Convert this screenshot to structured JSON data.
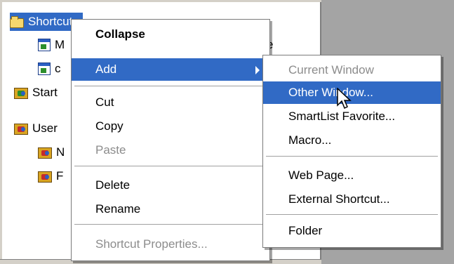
{
  "tree": {
    "items": [
      {
        "label": "Shortcuts",
        "icon": "folder-icon"
      },
      {
        "label": "M",
        "icon": "window-icon"
      },
      {
        "label": "c",
        "icon": "window-icon"
      },
      {
        "label": "Start",
        "icon": "group-icon-green"
      },
      {
        "label": "User",
        "icon": "group-icon"
      },
      {
        "label": "N",
        "icon": "group-icon"
      },
      {
        "label": "F",
        "icon": "group-icon"
      }
    ],
    "partial_text": "e"
  },
  "context_menu": {
    "collapse": "Collapse",
    "add": "Add",
    "cut": "Cut",
    "copy": "Copy",
    "paste": "Paste",
    "delete": "Delete",
    "rename": "Rename",
    "shortcut_properties": "Shortcut Properties..."
  },
  "add_submenu": {
    "current_window": "Current Window",
    "other_window": "Other Window...",
    "smartlist_favorite": "SmartList Favorite...",
    "macro": "Macro...",
    "web_page": "Web Page...",
    "external_shortcut": "External Shortcut...",
    "folder": "Folder"
  },
  "colors": {
    "highlight": "#316ac5",
    "disabled_text": "#8c8c8c",
    "background": "#a4a4a4"
  }
}
